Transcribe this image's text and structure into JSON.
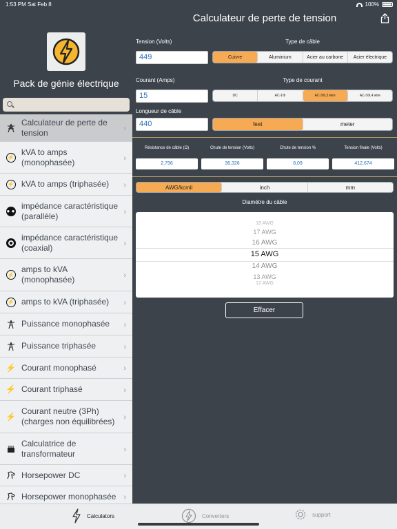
{
  "status": {
    "time": "1:53 PM",
    "date": "Sat Feb 8",
    "battery": "100%"
  },
  "header": {
    "title": "Calculateur de perte de tension",
    "share_icon": "share-icon"
  },
  "sidebar": {
    "title": "Pack de génie électrique",
    "search_placeholder": "",
    "items": [
      {
        "label": "Calculateur de perte de tension",
        "icon": "transmission-tower-icon",
        "active": true
      },
      {
        "label": "kVA to amps (monophasée)",
        "icon": "bolt-circle-icon"
      },
      {
        "label": "kVA to amps (triphasée)",
        "icon": "bolt-circle-icon"
      },
      {
        "label": "impédance caractéristique (parallèle)",
        "icon": "parallel-cable-icon"
      },
      {
        "label": "impédance caractéristique (coaxial)",
        "icon": "coaxial-icon"
      },
      {
        "label": "amps to kVA (monophasée)",
        "icon": "bolt-circle-icon"
      },
      {
        "label": "amps to kVA (triphasée)",
        "icon": "bolt-circle-icon"
      },
      {
        "label": "Puissance monophasée",
        "icon": "pylon-icon"
      },
      {
        "label": "Puissance triphasée",
        "icon": "pylon-icon"
      },
      {
        "label": "Courant monophasé",
        "icon": "bolt-icon"
      },
      {
        "label": "Courant triphasé",
        "icon": "bolt-icon"
      },
      {
        "label": "Courant neutre (3Ph) (charges non équilibrées)",
        "icon": "bolt-icon"
      },
      {
        "label": "Calculatrice de transformateur",
        "icon": "transformer-icon"
      },
      {
        "label": "Horsepower DC",
        "icon": "horse-icon"
      },
      {
        "label": "Horsepower monophasée",
        "icon": "horse-icon"
      }
    ]
  },
  "form": {
    "voltage_label": "Tension (Volts)",
    "voltage_value": "449",
    "cable_type_label": "Type de câble",
    "cable_types": [
      "Cuivre",
      "Aluminium",
      "Acier au carbone",
      "Acier électrique"
    ],
    "cable_selected": "Cuivre",
    "current_label": "Courant (Amps)",
    "current_value": "15",
    "current_type_label": "Type de courant",
    "current_types": [
      "DC",
      "AC-1Φ",
      "AC-3Φ,3 wire",
      "AC-3Φ,4 wire"
    ],
    "current_selected": "AC-3Φ,3 wire",
    "length_label": "Longueur de câble",
    "length_value": "440",
    "length_units": [
      "feet",
      "meter"
    ],
    "length_selected": "feet"
  },
  "results": [
    {
      "label": "Résistance de câble (Ω)",
      "value": "2,796"
    },
    {
      "label": "Chute de tension (Volts)",
      "value": "36,326"
    },
    {
      "label": "Chute de tension %",
      "value": "8,09"
    },
    {
      "label": "Tension finale (Volts)",
      "value": "412,674"
    }
  ],
  "diameter": {
    "units": [
      "AWG/kcmil",
      "inch",
      "mm"
    ],
    "unit_selected": "AWG/kcmil",
    "label": "Diamètre du câble",
    "options": [
      "18 AWG",
      "17 AWG",
      "16 AWG",
      "15 AWG",
      "14 AWG",
      "13 AWG",
      "12 AWG"
    ],
    "selected": "15 AWG"
  },
  "clear_label": "Effacer",
  "tabs": [
    {
      "label": "Calculators",
      "icon": "bolt-icon",
      "active": true
    },
    {
      "label": "Converters",
      "icon": "bolt-circle-icon"
    },
    {
      "label": "support",
      "icon": "gear-icon"
    }
  ],
  "colors": {
    "accent": "#f5aa53",
    "background": "#3d434b",
    "sidebar": "#eef0f2",
    "value_text": "#2c6fb8"
  }
}
